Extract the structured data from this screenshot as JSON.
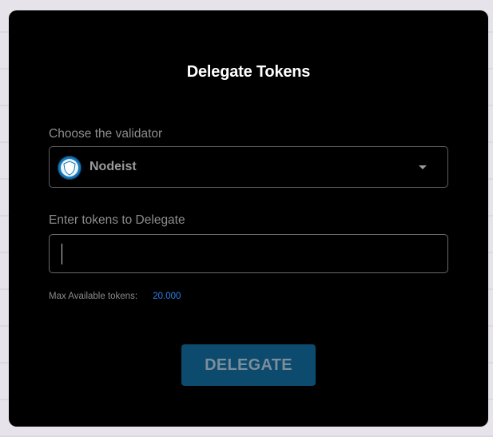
{
  "dialog": {
    "title": "Delegate Tokens"
  },
  "validator": {
    "label": "Choose the validator",
    "selected": "Nodeist",
    "icon": "shield-icon"
  },
  "tokens": {
    "label": "Enter tokens to Delegate",
    "value": "",
    "placeholder": ""
  },
  "max": {
    "label": "Max Available tokens:",
    "value": "20.000"
  },
  "actions": {
    "delegate_label": "DELEGATE"
  },
  "colors": {
    "background": "#000000",
    "accent": "#2f7fe8",
    "button": "#0c4a6e"
  }
}
